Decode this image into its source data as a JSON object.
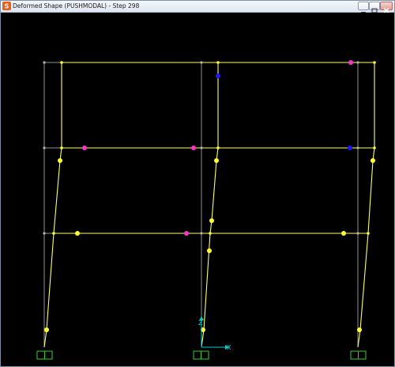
{
  "window": {
    "title": "Deformed Shape (PUSHMODAL) - Step 298",
    "app_icon": "sap2000-logo-icon",
    "controls": [
      "minimize-icon",
      "maximize-icon",
      "close-icon"
    ]
  },
  "view": {
    "background": "#000000",
    "colors": {
      "undeformed_frame": "#8f8f8f",
      "deformed_frame": "#ffff66",
      "hinge_yellow": "#ffff33",
      "hinge_magenta": "#ff33cc",
      "hinge_blue": "#1a1aff",
      "support": "#33cc33",
      "axis": "#00cccc"
    },
    "axes": {
      "z_label": "Z",
      "x_label": "X"
    }
  }
}
